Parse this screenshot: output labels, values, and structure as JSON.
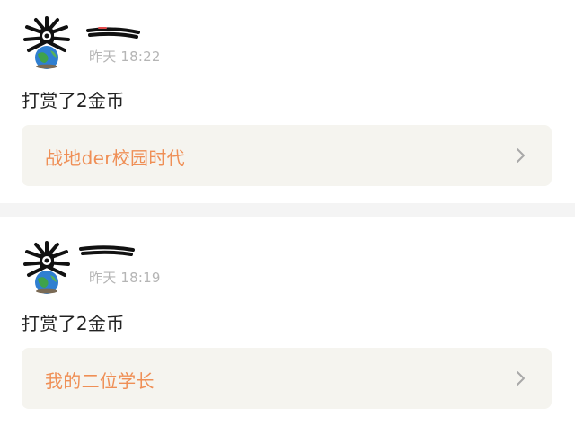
{
  "posts": [
    {
      "time": "昨天 18:22",
      "action": "打赏了2金币",
      "link_title": "战地der校园时代"
    },
    {
      "time": "昨天 18:19",
      "action": "打赏了2金币",
      "link_title": "我的二位学长"
    }
  ],
  "colors": {
    "link": "#ef8f56",
    "link_bg": "#f5f4ef",
    "time": "#b5b5b5",
    "separator": "#f4f4f4"
  },
  "icons": {
    "avatar": "avatar-icon",
    "chevron": "chevron-right-icon"
  }
}
